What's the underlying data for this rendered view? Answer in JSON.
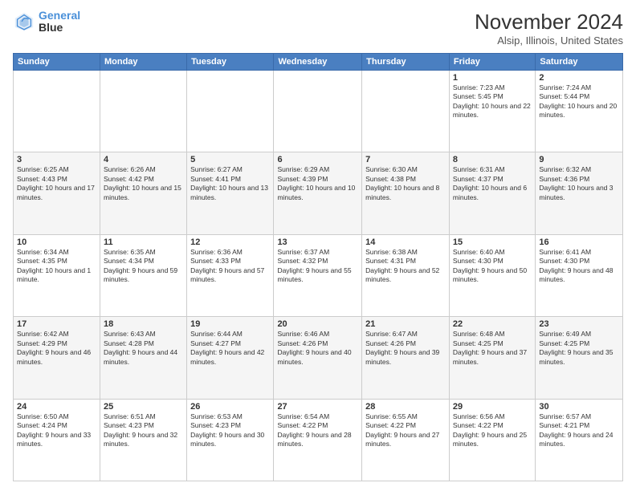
{
  "header": {
    "logo_line1": "General",
    "logo_line2": "Blue",
    "title": "November 2024",
    "subtitle": "Alsip, Illinois, United States"
  },
  "weekdays": [
    "Sunday",
    "Monday",
    "Tuesday",
    "Wednesday",
    "Thursday",
    "Friday",
    "Saturday"
  ],
  "weeks": [
    [
      {
        "day": "",
        "info": ""
      },
      {
        "day": "",
        "info": ""
      },
      {
        "day": "",
        "info": ""
      },
      {
        "day": "",
        "info": ""
      },
      {
        "day": "",
        "info": ""
      },
      {
        "day": "1",
        "info": "Sunrise: 7:23 AM\nSunset: 5:45 PM\nDaylight: 10 hours and 22 minutes."
      },
      {
        "day": "2",
        "info": "Sunrise: 7:24 AM\nSunset: 5:44 PM\nDaylight: 10 hours and 20 minutes."
      }
    ],
    [
      {
        "day": "3",
        "info": "Sunrise: 6:25 AM\nSunset: 4:43 PM\nDaylight: 10 hours and 17 minutes."
      },
      {
        "day": "4",
        "info": "Sunrise: 6:26 AM\nSunset: 4:42 PM\nDaylight: 10 hours and 15 minutes."
      },
      {
        "day": "5",
        "info": "Sunrise: 6:27 AM\nSunset: 4:41 PM\nDaylight: 10 hours and 13 minutes."
      },
      {
        "day": "6",
        "info": "Sunrise: 6:29 AM\nSunset: 4:39 PM\nDaylight: 10 hours and 10 minutes."
      },
      {
        "day": "7",
        "info": "Sunrise: 6:30 AM\nSunset: 4:38 PM\nDaylight: 10 hours and 8 minutes."
      },
      {
        "day": "8",
        "info": "Sunrise: 6:31 AM\nSunset: 4:37 PM\nDaylight: 10 hours and 6 minutes."
      },
      {
        "day": "9",
        "info": "Sunrise: 6:32 AM\nSunset: 4:36 PM\nDaylight: 10 hours and 3 minutes."
      }
    ],
    [
      {
        "day": "10",
        "info": "Sunrise: 6:34 AM\nSunset: 4:35 PM\nDaylight: 10 hours and 1 minute."
      },
      {
        "day": "11",
        "info": "Sunrise: 6:35 AM\nSunset: 4:34 PM\nDaylight: 9 hours and 59 minutes."
      },
      {
        "day": "12",
        "info": "Sunrise: 6:36 AM\nSunset: 4:33 PM\nDaylight: 9 hours and 57 minutes."
      },
      {
        "day": "13",
        "info": "Sunrise: 6:37 AM\nSunset: 4:32 PM\nDaylight: 9 hours and 55 minutes."
      },
      {
        "day": "14",
        "info": "Sunrise: 6:38 AM\nSunset: 4:31 PM\nDaylight: 9 hours and 52 minutes."
      },
      {
        "day": "15",
        "info": "Sunrise: 6:40 AM\nSunset: 4:30 PM\nDaylight: 9 hours and 50 minutes."
      },
      {
        "day": "16",
        "info": "Sunrise: 6:41 AM\nSunset: 4:30 PM\nDaylight: 9 hours and 48 minutes."
      }
    ],
    [
      {
        "day": "17",
        "info": "Sunrise: 6:42 AM\nSunset: 4:29 PM\nDaylight: 9 hours and 46 minutes."
      },
      {
        "day": "18",
        "info": "Sunrise: 6:43 AM\nSunset: 4:28 PM\nDaylight: 9 hours and 44 minutes."
      },
      {
        "day": "19",
        "info": "Sunrise: 6:44 AM\nSunset: 4:27 PM\nDaylight: 9 hours and 42 minutes."
      },
      {
        "day": "20",
        "info": "Sunrise: 6:46 AM\nSunset: 4:26 PM\nDaylight: 9 hours and 40 minutes."
      },
      {
        "day": "21",
        "info": "Sunrise: 6:47 AM\nSunset: 4:26 PM\nDaylight: 9 hours and 39 minutes."
      },
      {
        "day": "22",
        "info": "Sunrise: 6:48 AM\nSunset: 4:25 PM\nDaylight: 9 hours and 37 minutes."
      },
      {
        "day": "23",
        "info": "Sunrise: 6:49 AM\nSunset: 4:25 PM\nDaylight: 9 hours and 35 minutes."
      }
    ],
    [
      {
        "day": "24",
        "info": "Sunrise: 6:50 AM\nSunset: 4:24 PM\nDaylight: 9 hours and 33 minutes."
      },
      {
        "day": "25",
        "info": "Sunrise: 6:51 AM\nSunset: 4:23 PM\nDaylight: 9 hours and 32 minutes."
      },
      {
        "day": "26",
        "info": "Sunrise: 6:53 AM\nSunset: 4:23 PM\nDaylight: 9 hours and 30 minutes."
      },
      {
        "day": "27",
        "info": "Sunrise: 6:54 AM\nSunset: 4:22 PM\nDaylight: 9 hours and 28 minutes."
      },
      {
        "day": "28",
        "info": "Sunrise: 6:55 AM\nSunset: 4:22 PM\nDaylight: 9 hours and 27 minutes."
      },
      {
        "day": "29",
        "info": "Sunrise: 6:56 AM\nSunset: 4:22 PM\nDaylight: 9 hours and 25 minutes."
      },
      {
        "day": "30",
        "info": "Sunrise: 6:57 AM\nSunset: 4:21 PM\nDaylight: 9 hours and 24 minutes."
      }
    ]
  ]
}
